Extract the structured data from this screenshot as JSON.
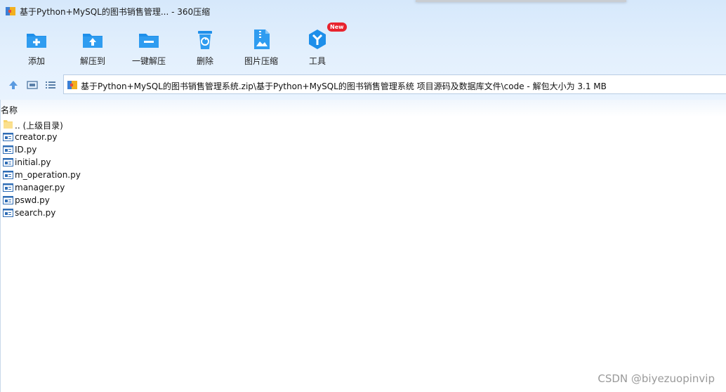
{
  "window": {
    "title": "基于Python+MySQL的图书销售管理... - 360压缩"
  },
  "toolbar": {
    "items": [
      {
        "label": "添加",
        "icon": "add-folder-icon"
      },
      {
        "label": "解压到",
        "icon": "extract-to-icon"
      },
      {
        "label": "一键解压",
        "icon": "one-click-extract-icon"
      },
      {
        "label": "删除",
        "icon": "recycle-bin-icon"
      },
      {
        "label": "图片压缩",
        "icon": "image-compress-icon"
      },
      {
        "label": "工具",
        "icon": "tools-icon",
        "badge": "New"
      }
    ]
  },
  "nav": {
    "path": "基于Python+MySQL的图书销售管理系统.zip\\基于Python+MySQL的图书销售管理系统 项目源码及数据库文件\\code - 解包大小为 3.1 MB"
  },
  "list": {
    "column_name": "名称",
    "items": [
      {
        "name": ".. (上级目录)",
        "icon": "folder-icon"
      },
      {
        "name": "creator.py",
        "icon": "file-icon"
      },
      {
        "name": "ID.py",
        "icon": "file-icon"
      },
      {
        "name": "initial.py",
        "icon": "file-icon"
      },
      {
        "name": "m_operation.py",
        "icon": "file-icon"
      },
      {
        "name": "manager.py",
        "icon": "file-icon"
      },
      {
        "name": "pswd.py",
        "icon": "file-icon"
      },
      {
        "name": "search.py",
        "icon": "file-icon"
      }
    ]
  },
  "watermark": "CSDN @biyezuopinvip",
  "colors": {
    "accent": "#1e8fea",
    "header_bg": "#e3f0fd",
    "badge": "#e8232e"
  }
}
